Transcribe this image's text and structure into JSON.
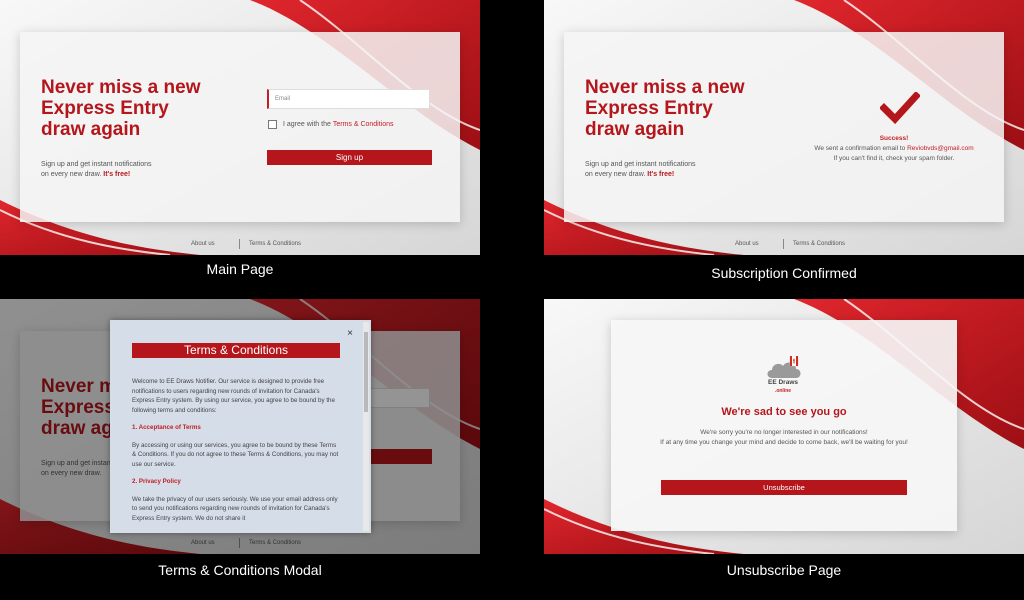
{
  "shared": {
    "hero_title_1": "Never miss a new",
    "hero_title_2": "Express Entry",
    "hero_title_3": "draw again",
    "subtitle_1": "Sign up and get instant notifications",
    "subtitle_2": "on every new draw.",
    "subtitle_free": "It's free!",
    "footer_about": "About us",
    "footer_terms": "Terms & Conditions",
    "brand_red": "#b5161c"
  },
  "main": {
    "caption": "Main Page",
    "email_placeholder": "Email",
    "agree_text": "I agree with the",
    "agree_link": "Terms & Conditions",
    "signup_label": "Sign up"
  },
  "confirmed": {
    "caption": "Subscription Confirmed",
    "success": "Success!",
    "sent_text": "We sent a confirmation email to",
    "email": "Reviobvds@gmail.com",
    "spam_text": "If you can't find it, check your spam folder."
  },
  "modal": {
    "caption": "Terms & Conditions Modal",
    "title": "Terms & Conditions",
    "intro": "Welcome to EE Draws Notifier. Our service is designed to provide free notifications to users regarding new rounds of invitation for Canada's Express Entry system. By using our service, you agree to be bound by the following terms and conditions:",
    "h1": "1. Acceptance of Terms",
    "p1": "By accessing or using our services, you agree to be bound by these Terms & Conditions. If you do not agree to these Terms & Conditions, you may not use our service.",
    "h2": "2. Privacy Policy",
    "p2": "We take the privacy of our users seriously. We use your email address only to send you notifications regarding new rounds of invitation for Canada's Express Entry system. We do not share it",
    "close": "×"
  },
  "unsubscribe": {
    "caption": "Unsubscribe Page",
    "logo_line1": "EE Draws",
    "logo_line2": ".online",
    "heading": "We're sad to see you go",
    "line1": "We're sorry you're no longer interested in our notifications!",
    "line2": "If at any time you change your mind and decide to come back, we'll be waiting for you!",
    "button": "Unsubscribe"
  }
}
